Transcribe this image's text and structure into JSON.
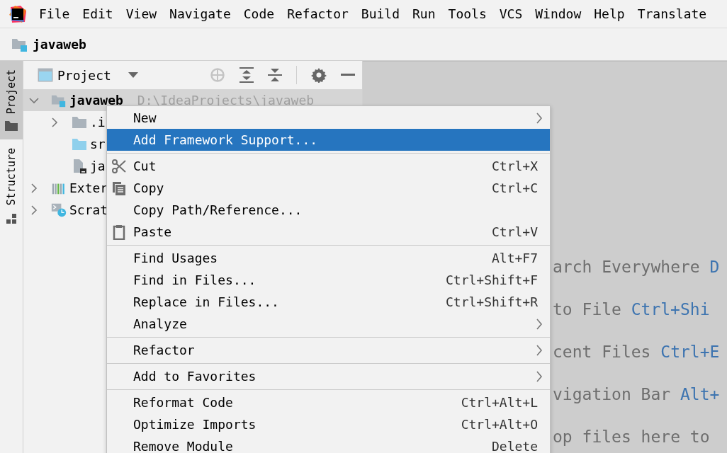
{
  "menu_bar": [
    "File",
    "Edit",
    "View",
    "Navigate",
    "Code",
    "Refactor",
    "Build",
    "Run",
    "Tools",
    "VCS",
    "Window",
    "Help",
    "Translate"
  ],
  "navigation_bar": {
    "project": "javaweb"
  },
  "tool_stripe": [
    {
      "label": "Project",
      "selected": true
    },
    {
      "label": "Structure",
      "selected": false
    }
  ],
  "project_panel": {
    "view": "Project",
    "tree": [
      {
        "label": "javaweb",
        "path": "D:\\IdeaProjects\\javaweb",
        "kind": "module",
        "expanded": true,
        "selected": true,
        "children": [
          {
            "label": ".i",
            "kind": "folder",
            "expanded": false,
            "selected": false
          },
          {
            "label": "sr",
            "kind": "source-folder",
            "selected": false
          },
          {
            "label": "ja",
            "kind": "file",
            "selected": false
          }
        ]
      },
      {
        "label": "Exter",
        "kind": "libraries",
        "expanded": false,
        "selected": false
      },
      {
        "label": "Scrat",
        "kind": "scratches",
        "expanded": false,
        "selected": false
      }
    ]
  },
  "editor_hints": [
    {
      "text": "arch Everywhere",
      "shortcut": "D"
    },
    {
      "text": "to File",
      "shortcut": "Ctrl+Shi"
    },
    {
      "text": "cent Files",
      "shortcut": "Ctrl+E"
    },
    {
      "text": "vigation Bar",
      "shortcut": "Alt+"
    },
    {
      "text": "op files here to"
    }
  ],
  "context_menu": {
    "sections": [
      [
        {
          "label": "New",
          "submenu": true,
          "selected": false
        },
        {
          "label": "Add Framework Support...",
          "submenu": false,
          "selected": true
        }
      ],
      [
        {
          "label": "Cut",
          "kind": "cut",
          "shortcut": "Ctrl+X",
          "submenu": false,
          "selected": false
        },
        {
          "label": "Copy",
          "kind": "copy",
          "shortcut": "Ctrl+C",
          "submenu": false,
          "selected": false
        },
        {
          "label": "Copy Path/Reference...",
          "submenu": false,
          "selected": false
        },
        {
          "label": "Paste",
          "kind": "paste",
          "shortcut": "Ctrl+V",
          "submenu": false,
          "selected": false
        }
      ],
      [
        {
          "label": "Find Usages",
          "shortcut": "Alt+F7",
          "submenu": false,
          "selected": false
        },
        {
          "label": "Find in Files...",
          "shortcut": "Ctrl+Shift+F",
          "submenu": false,
          "selected": false
        },
        {
          "label": "Replace in Files...",
          "shortcut": "Ctrl+Shift+R",
          "submenu": false,
          "selected": false
        },
        {
          "label": "Analyze",
          "submenu": true,
          "selected": false
        }
      ],
      [
        {
          "label": "Refactor",
          "submenu": true,
          "selected": false
        }
      ],
      [
        {
          "label": "Add to Favorites",
          "submenu": true,
          "selected": false
        }
      ],
      [
        {
          "label": "Reformat Code",
          "shortcut": "Ctrl+Alt+L",
          "submenu": false,
          "selected": false
        },
        {
          "label": "Optimize Imports",
          "shortcut": "Ctrl+Alt+O",
          "submenu": false,
          "selected": false
        },
        {
          "label": "Remove Module",
          "shortcut": "Delete",
          "submenu": false,
          "selected": false
        }
      ]
    ]
  }
}
